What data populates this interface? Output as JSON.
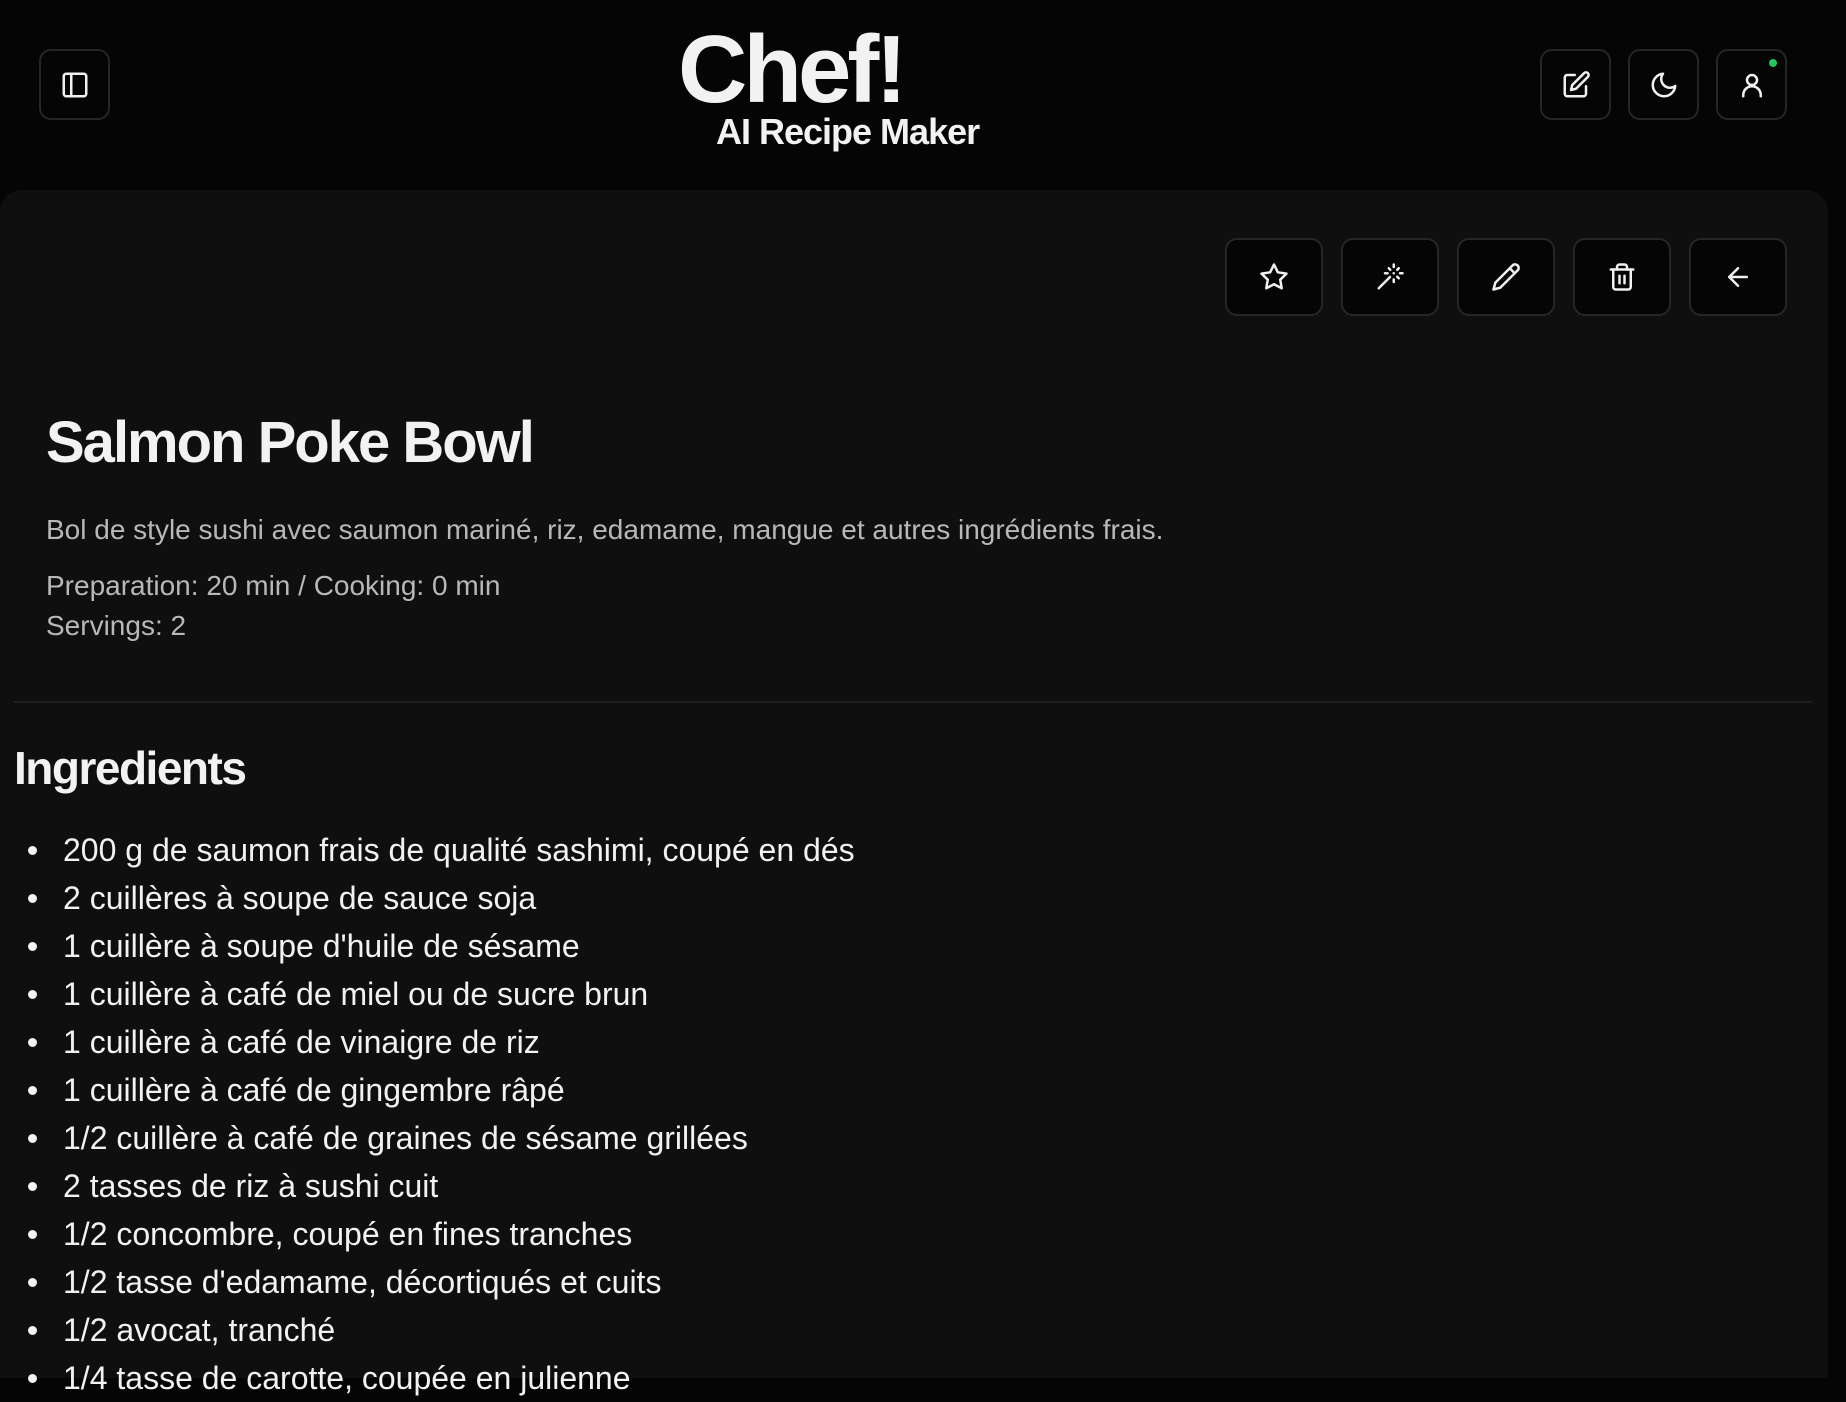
{
  "header": {
    "brand_title": "Chef!",
    "brand_subtitle": "AI Recipe Maker",
    "icons": {
      "sidebar_toggle": "sidebar-icon",
      "new_recipe": "edit-square-icon",
      "theme": "moon-icon",
      "account": "user-icon"
    },
    "status_color": "#22c55e"
  },
  "actions": [
    {
      "name": "favorite",
      "icon": "star-icon"
    },
    {
      "name": "ai-improve",
      "icon": "magic-wand-icon"
    },
    {
      "name": "edit",
      "icon": "pencil-icon"
    },
    {
      "name": "delete",
      "icon": "trash-icon"
    },
    {
      "name": "back",
      "icon": "arrow-left-icon"
    }
  ],
  "recipe": {
    "title": "Salmon Poke Bowl",
    "description": "Bol de style sushi avec saumon mariné, riz, edamame, mangue et autres ingrédients frais.",
    "time": "Preparation: 20 min / Cooking: 0 min",
    "servings": "Servings: 2"
  },
  "ingredients": {
    "heading": "Ingredients",
    "items": [
      "200 g de saumon frais de qualité sashimi, coupé en dés",
      "2 cuillères à soupe de sauce soja",
      "1 cuillère à soupe d'huile de sésame",
      "1 cuillère à café de miel ou de sucre brun",
      "1 cuillère à café de vinaigre de riz",
      "1 cuillère à café de gingembre râpé",
      "1/2 cuillère à café de graines de sésame grillées",
      "2 tasses de riz à sushi cuit",
      "1/2 concombre, coupé en fines tranches",
      "1/2 tasse d'edamame, décortiqués et cuits",
      "1/2 avocat, tranché",
      "1/4 tasse de carotte, coupée en julienne"
    ]
  },
  "colors": {
    "background": "#050505",
    "panel": "#0f0f0f",
    "text": "#f2f2f2",
    "muted_text": "#b8b8b8",
    "border": "#262626"
  }
}
